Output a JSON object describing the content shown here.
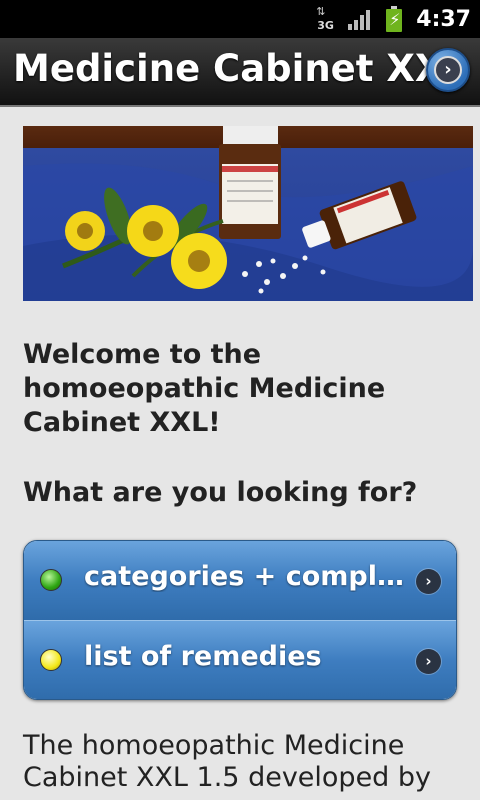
{
  "status_bar": {
    "network": "3G",
    "time": "4:37"
  },
  "header": {
    "title": "Medicine Cabinet XXL",
    "next_icon": "chevron-right-icon"
  },
  "welcome": "Welcome to the homoeopathic Medicine Cabinet XXL!",
  "question": "What are you looking for?",
  "menu": {
    "items": [
      {
        "label": "categories + compl…",
        "indicator_color": "#2ea613",
        "icon": "chevron-right-icon"
      },
      {
        "label": "list of remedies",
        "indicator_color": "#f3e81b",
        "icon": "chevron-right-icon"
      }
    ]
  },
  "description": "The homoeopathic Medicine Cabinet XXL 1.5 developed by"
}
